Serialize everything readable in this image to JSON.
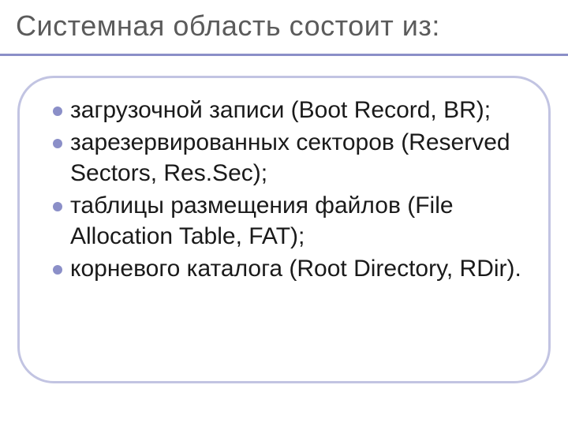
{
  "title": "Системная область состоит из:",
  "bullets": [
    "загрузочной записи (Bооt Record, ВR);",
    "зарезервированных секторов (Reserved Sectors, Res.Sec);",
    "таблицы размещения файлов (File Allocation Table, FAT);",
    "корневого каталога (Root Directory, RDir)."
  ],
  "colors": {
    "accent": "#8b8fc8",
    "border": "#c2c4e2",
    "title_text": "#5b5b5b",
    "body_text": "#1a1a1a"
  }
}
